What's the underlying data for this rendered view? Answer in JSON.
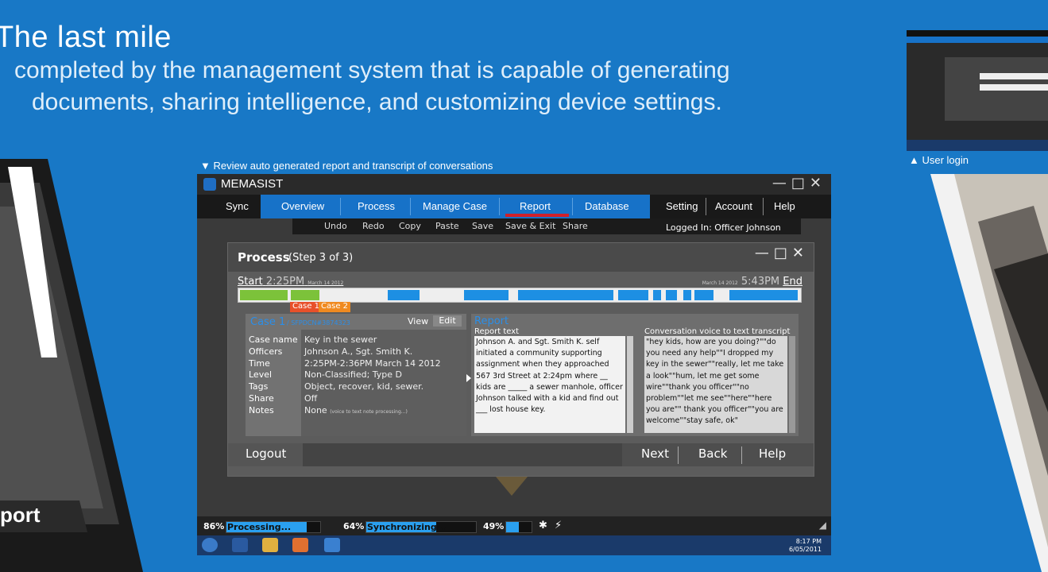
{
  "page": {
    "heading": "The last mile",
    "subtitle_line1": "completed by the management system that is capable of generating",
    "subtitle_line2": "documents, sharing intelligence, and customizing device settings.",
    "left_label": "port",
    "review_caption": "▼ Review auto generated report and transcript of conversations",
    "login_caption": "▲ User login"
  },
  "app": {
    "title": "MEMASIST",
    "window_controls": "—□✕",
    "sync_tab": "Sync",
    "tabs": [
      "Overview",
      "Process",
      "Manage Case",
      "Report",
      "Database"
    ],
    "active_tab": "Report",
    "right_menu": [
      "Setting",
      "Account",
      "Help"
    ],
    "toolbar": [
      "Undo",
      "Redo",
      "Copy",
      "Paste",
      "Save",
      "Save & Exit",
      "Share"
    ],
    "logged_in": "Logged In: Officer Johnson"
  },
  "process": {
    "title": "Process",
    "step": "(Step 3 of 3)",
    "start_label": "Start",
    "start_time": "2:25PM",
    "start_date": "March 14 2012",
    "end_date": "March 14 2012",
    "end_time": "5:43PM",
    "end_label": "End",
    "case_tags": [
      "Case 1",
      "Case 2"
    ]
  },
  "case": {
    "title": "Case 1",
    "id": "/ SFPDCN#3874323",
    "view_label": "View",
    "edit_label": "Edit",
    "fields": [
      {
        "label": "Case name",
        "value": "Key in the sewer"
      },
      {
        "label": "Officers",
        "value": "Johnson A., Sgt. Smith K."
      },
      {
        "label": "Time",
        "value": "2:25PM-2:36PM March 14 2012"
      },
      {
        "label": "Level",
        "value": "Non-Classified; Type D"
      },
      {
        "label": "Tags",
        "value": "Object, recover, kid, sewer."
      },
      {
        "label": "Share",
        "value": "Off"
      },
      {
        "label": "Notes",
        "value": "None"
      }
    ],
    "notes_hint": "(voice to text note processing...)"
  },
  "report": {
    "title": "Report",
    "text_title": "Report text",
    "text": "Johnson A. and Sgt. Smith K. self initiated a community supporting assignment when they approached 567 3rd Street at 2:24pm where __ kids are _____ a sewer manhole, officer Johnson talked with a kid and find out ___ lost house key.",
    "transcript_title": "Conversation voice to text transcript",
    "transcript": "\"hey kids, how are you doing?\"\"do you need any help\"\"I dropped my key in the sewer\"\"really, let me take a look\"\"hum, let me get some wire\"\"thank you officer\"\"no problem\"\"let me see\"\"here\"\"here you are\"\" thank you officer\"\"you are welcome\"\"stay safe, ok\""
  },
  "footer": {
    "logout": "Logout",
    "next": "Next",
    "back": "Back",
    "help": "Help"
  },
  "status": {
    "processing_pct": "86%",
    "processing_label": "Processing...",
    "processing_value": 0.86,
    "sync_pct": "64%",
    "sync_label": "Synchronizing...",
    "sync_value": 0.64,
    "battery_pct": "49%",
    "battery_value": 0.49
  },
  "taskbar": {
    "time": "8:17 PM",
    "date": "6/05/2011"
  },
  "colors": {
    "background": "#1878c6",
    "accent_blue": "#1d8fe3",
    "timeline_green": "#7cc23a",
    "case1_tag": "#e8502a",
    "case2_tag": "#f08a20"
  }
}
